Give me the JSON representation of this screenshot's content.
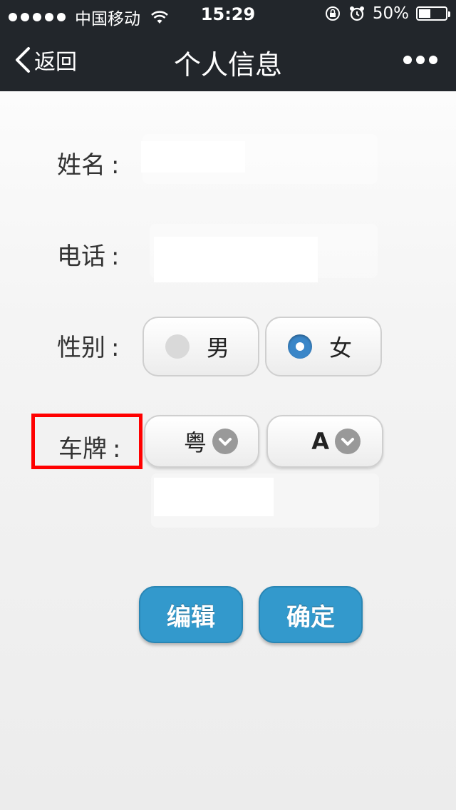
{
  "status_bar": {
    "carrier": "中国移动",
    "time": "15:29",
    "battery": "50%",
    "battery_level": 0.5
  },
  "nav": {
    "back_label": "返回",
    "title": "个人信息"
  },
  "form": {
    "name_label": "姓名",
    "name_value": "",
    "phone_label": "电话",
    "phone_value": "",
    "gender_label": "性别",
    "gender_options": [
      "男",
      "女"
    ],
    "gender_selected": "女",
    "plate_label": "车牌",
    "plate_province": "粤",
    "plate_letter": "A",
    "plate_number": "",
    "colon": ":"
  },
  "actions": {
    "edit_label": "编辑",
    "confirm_label": "确定"
  }
}
